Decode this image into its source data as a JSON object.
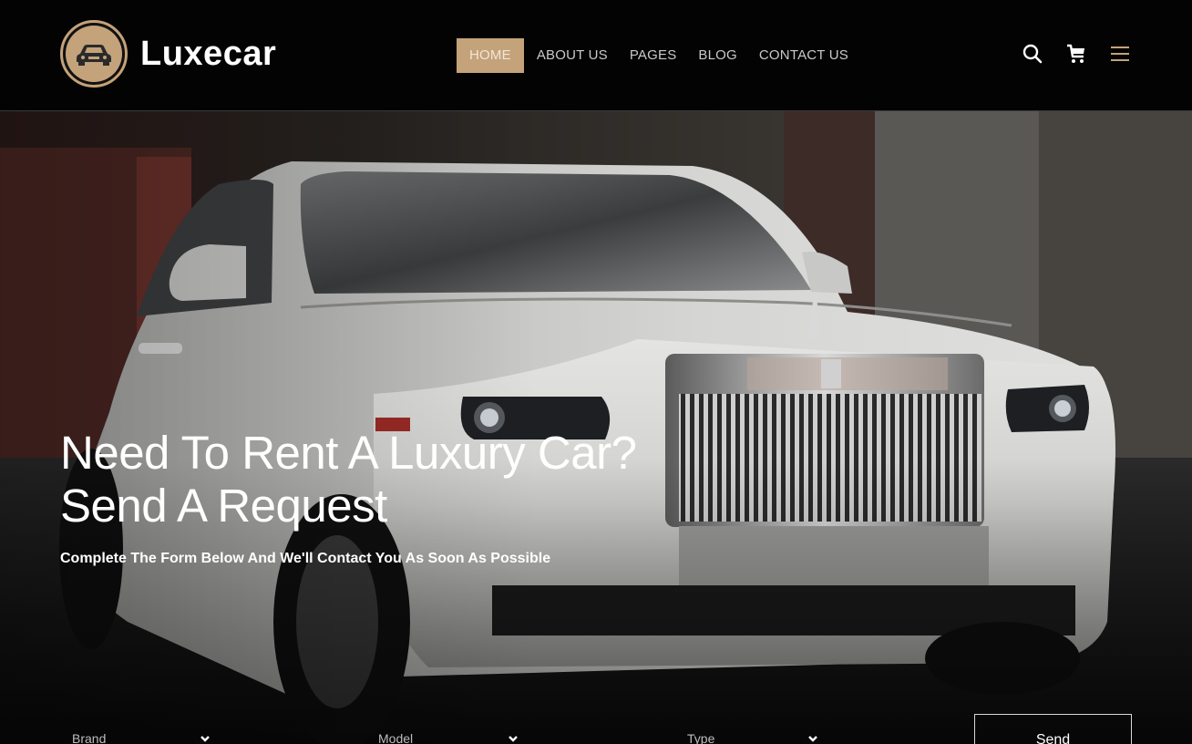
{
  "brand": {
    "name": "Luxecar",
    "accent_color": "#c4a27a",
    "logo_icon": "car-icon"
  },
  "nav": {
    "items": [
      {
        "label": "HOME",
        "active": true
      },
      {
        "label": "ABOUT US",
        "active": false
      },
      {
        "label": "PAGES",
        "active": false
      },
      {
        "label": "BLOG",
        "active": false
      },
      {
        "label": "CONTACT US",
        "active": false
      }
    ]
  },
  "header_icons": {
    "search": "search-icon",
    "cart": "cart-icon",
    "menu": "hamburger-menu-icon"
  },
  "hero": {
    "image": "white luxury car photo",
    "title_line1": "Need To Rent A Luxury Car?",
    "title_line2": "Send A Request",
    "subtitle": "Complete The Form Below And We'll Contact You As Soon As Possible"
  },
  "form": {
    "brand_label": "Brand",
    "model_label": "Model",
    "type_label": "Type",
    "send_label": "Send"
  }
}
